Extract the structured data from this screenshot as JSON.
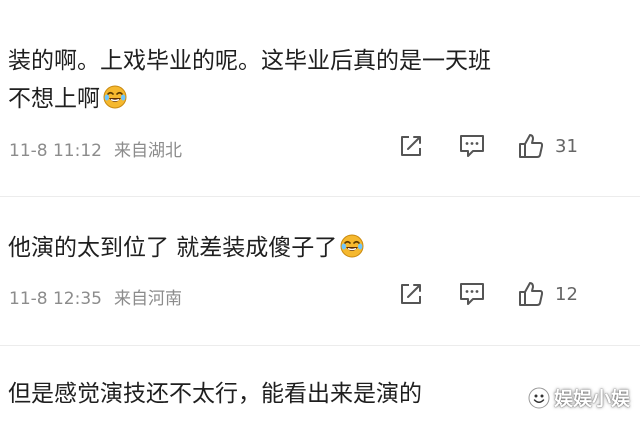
{
  "comments": [
    {
      "text_line1": "装的啊。上戏毕业的呢。这毕业后真的是一天班",
      "text_line2": "不想上啊",
      "emoji": "laughing-tears-emoji",
      "time": "11-8 11:12",
      "location": "来自湖北",
      "likes": "31"
    },
    {
      "text_line1": "他演的太到位了 就差装成傻子了",
      "emoji": "laughing-tears-emoji",
      "time": "11-8 12:35",
      "location": "来自河南",
      "likes": "12"
    },
    {
      "text_line1": "但是感觉演技还不太行，能看出来是演的"
    }
  ],
  "icons": {
    "share": "share-icon",
    "comment": "comment-icon",
    "like": "like-icon"
  },
  "watermark": {
    "text": "娱娱小娱"
  },
  "colors": {
    "text": "#1f1f1f",
    "meta": "#8c8c8c",
    "icon": "#555555",
    "emoji": "#f5b82e"
  }
}
